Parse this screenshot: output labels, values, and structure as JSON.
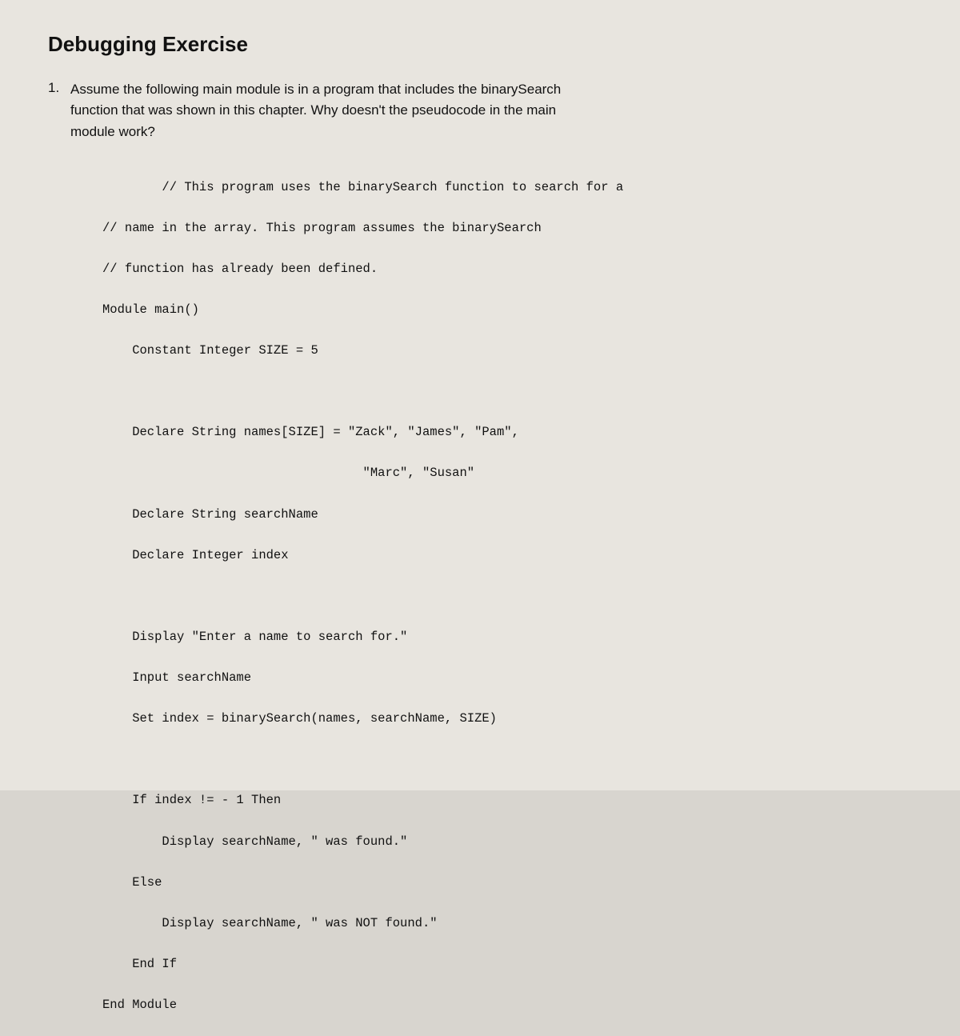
{
  "title": "Debugging Exercise",
  "question": {
    "number": "1.",
    "text_line1": "Assume the following main module is in a program that includes the binarySearch",
    "text_line2": "function that was shown in this chapter. Why doesn't the pseudocode in the main",
    "text_line3": "module work?",
    "code": {
      "comment1": "// This program uses the binarySearch function to search for a",
      "comment2": "// name in the array. This program assumes the binarySearch",
      "comment3": "// function has already been defined.",
      "module_decl": "Module main()",
      "constant": "    Constant Integer SIZE = 5",
      "blank1": "",
      "declare_names": "    Declare String names[SIZE] = \"Zack\", \"James\", \"Pam\",",
      "declare_names2": "                                   \"Marc\", \"Susan\"",
      "declare_searchName": "    Declare String searchName",
      "declare_index": "    Declare Integer index",
      "blank2": "",
      "display1": "    Display \"Enter a name to search for.\"",
      "input1": "    Input searchName",
      "set_index": "    Set index = binarySearch(names, searchName, SIZE)",
      "blank3": "",
      "if_stmt": "    If index != - 1 Then",
      "display2": "        Display searchName, \" was found.\"",
      "else_stmt": "    Else",
      "display3": "        Display searchName, \" was NOT found.\"",
      "end_if": "    End If",
      "end_module": "End Module"
    }
  }
}
